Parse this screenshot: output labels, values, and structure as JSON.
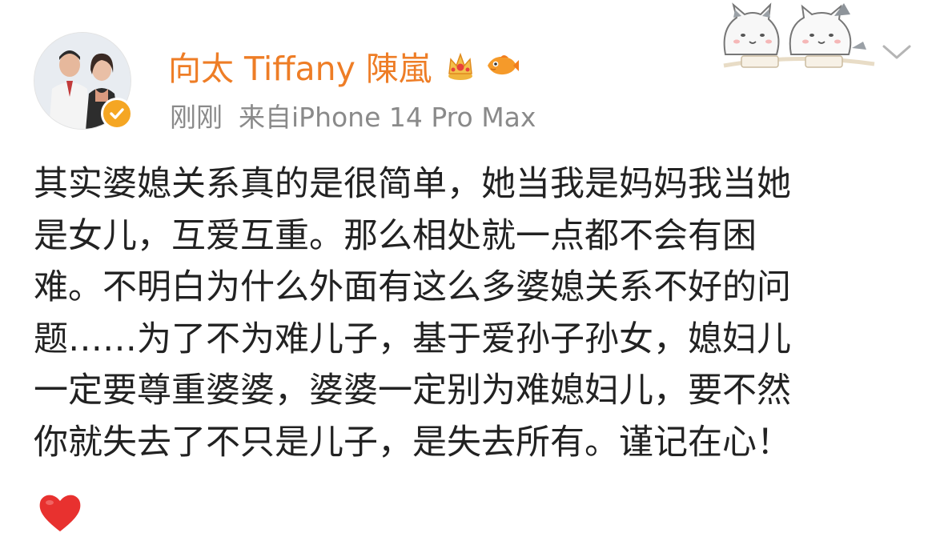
{
  "post": {
    "author": {
      "name": "向太 Tiffany 陳嵐",
      "verified_icon": "verified-badge-icon",
      "member_crown_icon": "crown-badge-icon",
      "fish_badge_icon": "fish-badge-icon"
    },
    "meta": {
      "time": "刚刚",
      "source": "来自iPhone 14 Pro Max"
    },
    "content_lines": [
      "其实婆媳关系真的是很简单，她当我是妈妈我当她",
      "是女儿，互爱互重。那么相处就一点都不会有困",
      "难。不明白为什么外面有这么多婆媳关系不好的问",
      "题……为了不为难儿子，基于爱孙子孙女，媳妇儿",
      "一定要尊重婆婆，婆婆一定别为难媳妇儿，要不然",
      "你就失去了不只是儿子，是失去所有。谨记在心！"
    ],
    "emoji": "red-heart-emoji"
  },
  "colors": {
    "username": "#ee7d26",
    "meta": "#8a8a8a",
    "text": "#222222",
    "verified": "#f5a623",
    "heart": "#e8312f"
  }
}
